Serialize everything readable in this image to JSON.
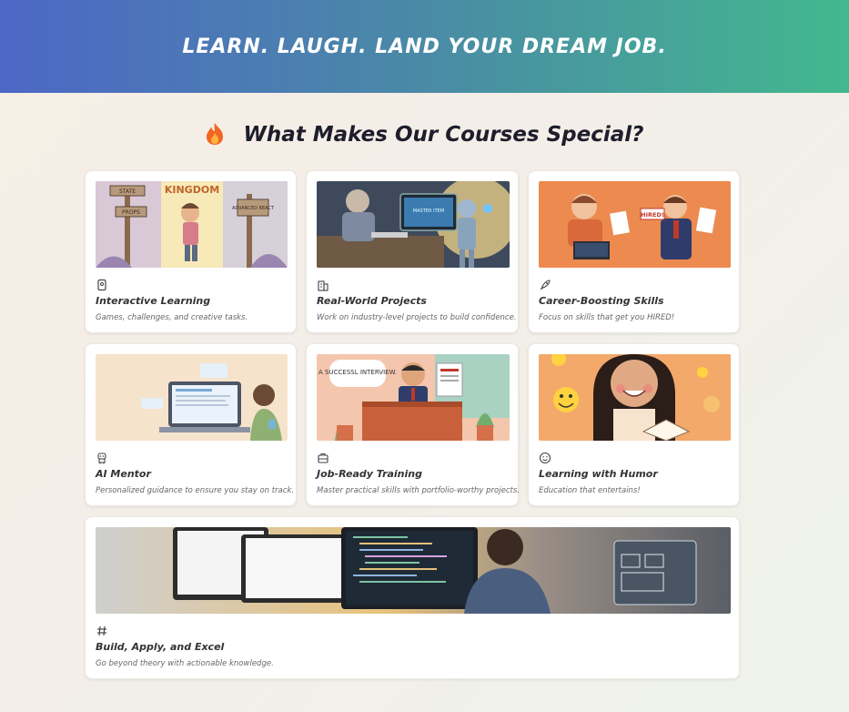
{
  "banner": {
    "title": "LEARN. LAUGH. LAND YOUR DREAM JOB."
  },
  "section": {
    "title": "What Makes Our Courses Special?",
    "title_icon": "fire-icon"
  },
  "features": [
    {
      "icon": "game-icon",
      "title": "Interactive Learning",
      "description": "Games, challenges, and creative tasks.",
      "image_text": [
        "STATE",
        "PROPS",
        "KINGDOM",
        "ADVANCED REACT"
      ]
    },
    {
      "icon": "building-icon",
      "title": "Real-World Projects",
      "description": "Work on industry-level projects to build confidence.",
      "image_text": [
        "MASTER ITEM"
      ]
    },
    {
      "icon": "rocket-icon",
      "title": "Career-Boosting Skills",
      "description": "Focus on skills that get you HIRED!",
      "image_text": [
        "HIRED!"
      ]
    },
    {
      "icon": "robot-icon",
      "title": "AI Mentor",
      "description": "Personalized guidance to ensure you stay on track."
    },
    {
      "icon": "briefcase-icon",
      "title": "Job-Ready Training",
      "description": "Master practical skills with portfolio-worthy projects.",
      "image_text": [
        "A SUCCESSL INTERVIEW."
      ]
    },
    {
      "icon": "smiley-icon",
      "title": "Learning with Humor",
      "description": "Education that entertains!"
    },
    {
      "icon": "hashtag-icon",
      "title": "Build, Apply, and Excel",
      "description": "Go beyond theory with actionable knowledge."
    }
  ],
  "colors": {
    "banner_start": "#4d67c6",
    "banner_end": "#43b88e"
  }
}
